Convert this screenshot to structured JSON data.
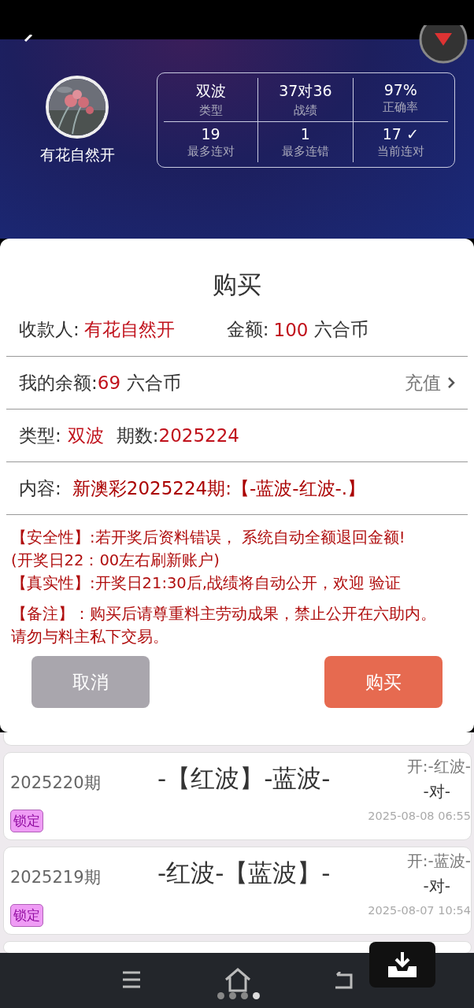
{
  "profile": {
    "name": "有花自然开"
  },
  "stats": [
    {
      "value": "双波",
      "label": "类型"
    },
    {
      "value": "37对36",
      "label": "战绩"
    },
    {
      "value": "97%",
      "label": "正确率"
    },
    {
      "value": "19",
      "label": "最多连对"
    },
    {
      "value": "1",
      "label": "最多连错"
    },
    {
      "value": "17 ✓",
      "label": "当前连对"
    }
  ],
  "dialog": {
    "title": "购买",
    "payee_label": "收款人:",
    "payee": "有花自然开",
    "amount_label": "金额:",
    "amount": "100",
    "amount_unit": "六合币",
    "balance_label": "我的余额:",
    "balance": "69",
    "balance_unit": "六合币",
    "recharge": "充值",
    "type_label": "类型:",
    "type": "双波",
    "period_label": "期数:",
    "period": "2025224",
    "content_label": "内容:",
    "content": "新澳彩2025224期:【-蓝波-红波-.】",
    "notices": [
      {
        "text": "【安全性】:若开奖后资料错误， 系统自动全额退回金额!"
      },
      {
        "text": "(开奖日22：00左右刷新账户)"
      },
      {
        "text": "【真实性】:开奖日21:30后,战绩将自动公开，欢迎 验证",
        "gap_after": true
      },
      {
        "text": "【备注】：购买后请尊重料主劳动成果，禁止公开在六助内。"
      },
      {
        "text": "请勿与料主私下交易。"
      }
    ],
    "cancel": "取消",
    "confirm": "购买"
  },
  "records": [
    {
      "period": "2025220期",
      "pick": "-【红波】-蓝波-",
      "result": "开:-红波-",
      "verdict": "-对-",
      "time": "2025-08-08 06:55",
      "badge": "锁定"
    },
    {
      "period": "2025219期",
      "pick": "-红波-【蓝波】-",
      "result": "开:-蓝波-",
      "verdict": "-对-",
      "time": "2025-08-07 10:54",
      "badge": "锁定"
    }
  ],
  "page_indicator": [
    {
      "selected": false
    },
    {
      "selected": false
    },
    {
      "selected": false
    },
    {
      "selected": true
    }
  ]
}
